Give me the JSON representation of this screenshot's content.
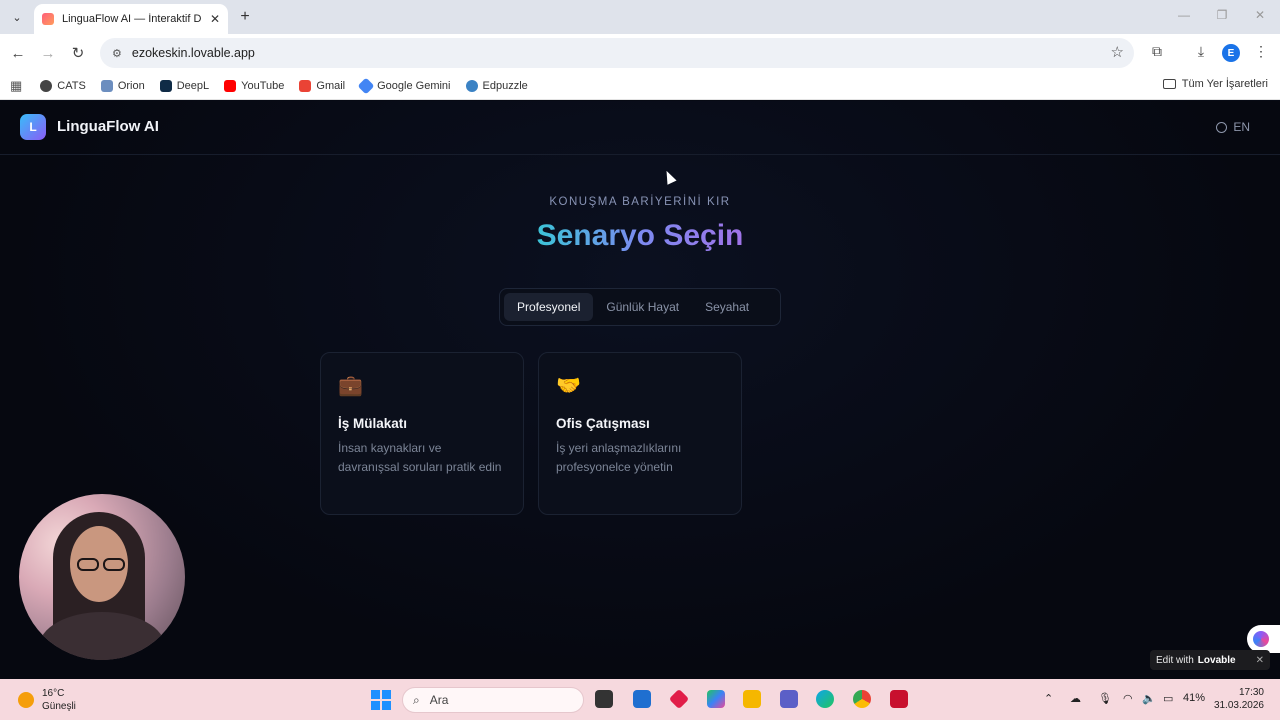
{
  "browser": {
    "tab_title": "LinguaFlow AI — İnteraktif Dil P",
    "url": "ezokeskin.lovable.app",
    "profile_initial": "E"
  },
  "bookmarks": {
    "items": [
      {
        "label": "CATS",
        "color": "#444444"
      },
      {
        "label": "Orion",
        "color": "#6c8ebf"
      },
      {
        "label": "DeepL",
        "color": "#0f2b46"
      },
      {
        "label": "YouTube",
        "color": "#ff0000"
      },
      {
        "label": "Gmail",
        "color": "#ea4335"
      },
      {
        "label": "Google Gemini",
        "color": "#4285f4"
      },
      {
        "label": "Edpuzzle",
        "color": "#3b82c4"
      }
    ],
    "all_label": "Tüm Yer İşaretleri"
  },
  "app": {
    "logo_letter": "L",
    "brand": "LinguaFlow AI",
    "language": "EN",
    "eyebrow": "KONUŞMA BARİYERİNİ KIR",
    "heading": "Senaryo Seçin",
    "tabs": [
      {
        "label": "Profesyonel",
        "active": true
      },
      {
        "label": "Günlük Hayat",
        "active": false
      },
      {
        "label": "Seyahat",
        "active": false
      }
    ],
    "cards": [
      {
        "icon": "💼",
        "title": "İş Mülakatı",
        "desc": "İnsan kaynakları ve davranışsal soruları pratik edin"
      },
      {
        "icon": "🤝",
        "title": "Ofis Çatışması",
        "desc": "İş yeri anlaşmazlıklarını profesyonelce yönetin"
      }
    ],
    "edit_with": "Edit with",
    "lovable": "Lovable"
  },
  "taskbar": {
    "temperature": "16°C",
    "weather": "Güneşli",
    "search_placeholder": "Ara",
    "battery": "41%",
    "time": "17:30",
    "date": "31.03.2026"
  }
}
